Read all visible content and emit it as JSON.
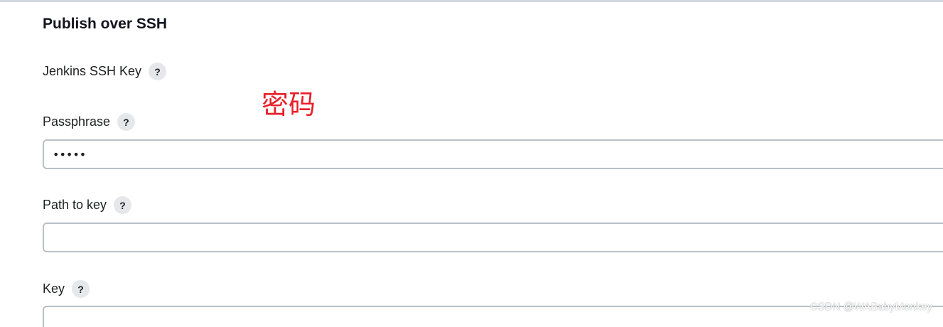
{
  "section": {
    "title": "Publish over SSH"
  },
  "fields": {
    "jenkins_ssh_key": {
      "label": "Jenkins SSH Key",
      "help": "?"
    },
    "passphrase": {
      "label": "Passphrase",
      "help": "?",
      "value": "•••••"
    },
    "path_to_key": {
      "label": "Path to key",
      "help": "?",
      "value": ""
    },
    "key": {
      "label": "Key",
      "help": "?",
      "value": ""
    }
  },
  "annotation": {
    "text": "密码",
    "color": "#e8202a"
  },
  "watermark": {
    "text": "CSDN @WABabyMonkey"
  }
}
